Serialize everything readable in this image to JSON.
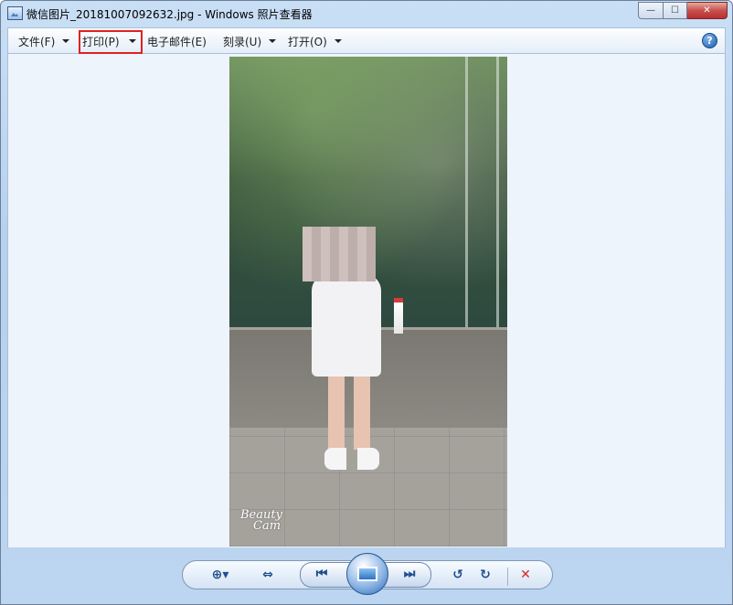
{
  "window": {
    "title": "微信图片_20181007092632.jpg - Windows 照片查看器",
    "minimize_glyph": "—",
    "maximize_glyph": "☐",
    "close_glyph": "✕"
  },
  "menu": {
    "file": "文件(F)",
    "print": "打印(P)",
    "email": "电子邮件(E)",
    "burn": "刻录(U)",
    "open": "打开(O)",
    "help_glyph": "?"
  },
  "photo": {
    "watermark_line1": "Beauty",
    "watermark_line2": "Cam"
  },
  "controls": {
    "zoom_glyph": "⊕▾",
    "fit_glyph": "⇔",
    "prev_glyph": "⏮",
    "next_glyph": "⏭",
    "rotate_ccw_glyph": "↺",
    "rotate_cw_glyph": "↻",
    "delete_glyph": "✕"
  },
  "colors": {
    "highlight_box": "#e0211f",
    "delete_red": "#d62b2b",
    "control_blue": "#1f4f8e"
  }
}
